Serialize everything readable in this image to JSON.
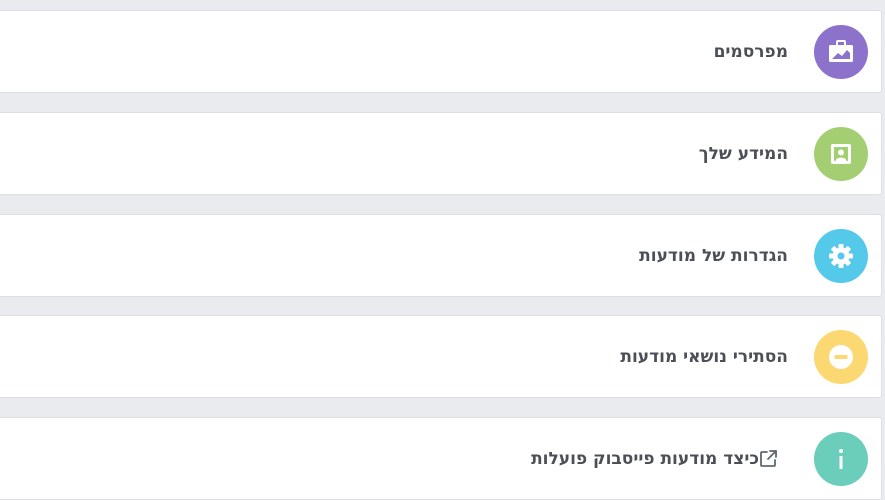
{
  "items": [
    {
      "label": "מפרסמים",
      "icon": "briefcase-icon",
      "color": "#8c72cb"
    },
    {
      "label": "המידע שלך",
      "icon": "contact-card-icon",
      "color": "#a3ce71"
    },
    {
      "label": "הגדרות של מודעות",
      "icon": "gear-icon",
      "color": "#55c9ea"
    },
    {
      "label": "הסתירי נושאי מודעות",
      "icon": "minus-circle-icon",
      "color": "#fcd872"
    },
    {
      "label": "כיצד מודעות פייסבוק פועלות",
      "icon": "info-icon",
      "color": "#6bcebb",
      "external_link_icon": "external-link-icon"
    }
  ],
  "colors": {
    "page_background": "#e9ebee",
    "card_background": "#ffffff",
    "text": "#4b4f56"
  }
}
